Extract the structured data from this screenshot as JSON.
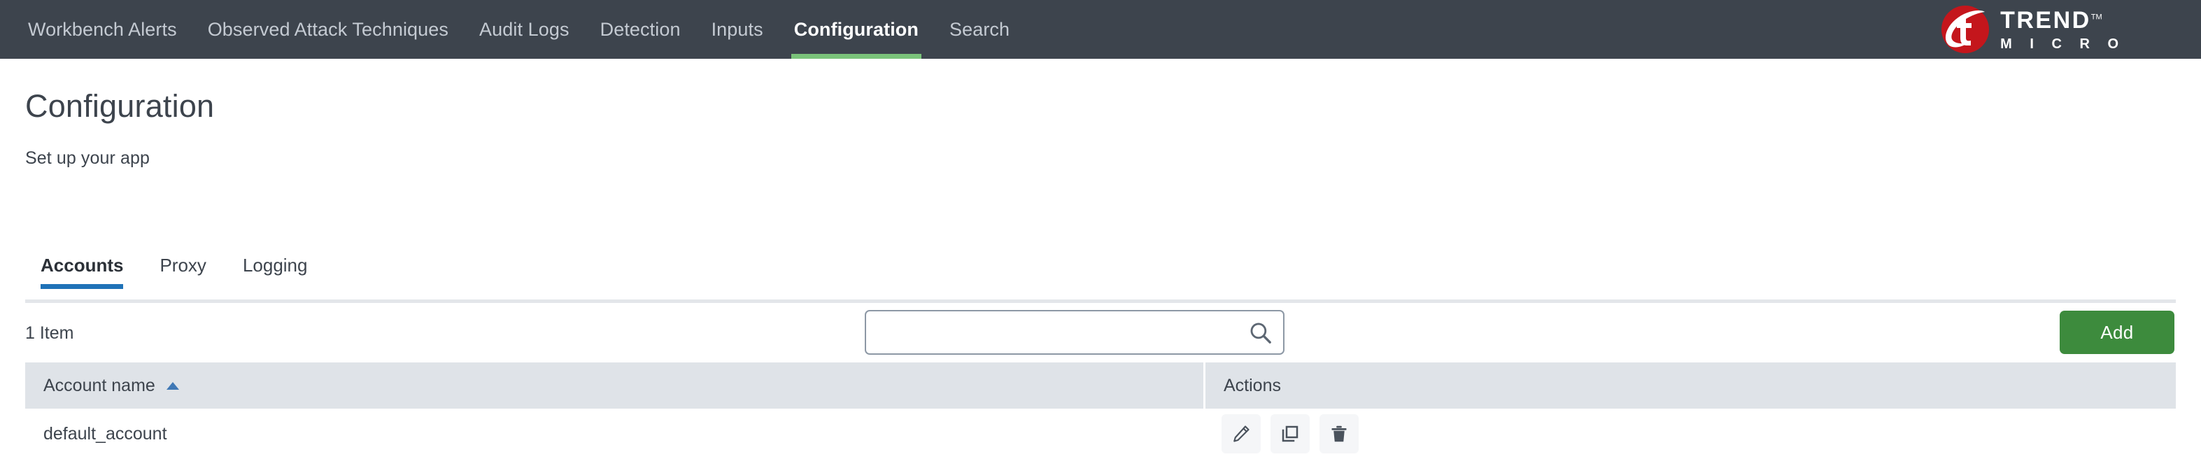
{
  "topnav": {
    "items": [
      {
        "label": "Workbench Alerts",
        "active": false
      },
      {
        "label": "Observed Attack Techniques",
        "active": false
      },
      {
        "label": "Audit Logs",
        "active": false
      },
      {
        "label": "Detection",
        "active": false
      },
      {
        "label": "Inputs",
        "active": false
      },
      {
        "label": "Configuration",
        "active": true
      },
      {
        "label": "Search",
        "active": false
      }
    ],
    "active_indicator_color": "#7ac37a",
    "background_color": "#3d444d"
  },
  "brand": {
    "name_line1": "TREND",
    "trademark": "TM",
    "name_line2": "M I C R O",
    "mark_color": "#c4161c"
  },
  "page": {
    "title": "Configuration",
    "subtitle": "Set up your app"
  },
  "subtabs": {
    "items": [
      {
        "label": "Accounts",
        "active": true
      },
      {
        "label": "Proxy",
        "active": false
      },
      {
        "label": "Logging",
        "active": false
      }
    ],
    "active_indicator_color": "#1f72b8"
  },
  "toolbar": {
    "item_count": "1 Item",
    "search_value": "",
    "search_placeholder": "",
    "search_icon": "search-icon",
    "add_label": "Add",
    "add_color": "#3d8b3d"
  },
  "table": {
    "columns": [
      {
        "label": "Account name",
        "sort": "ascending",
        "sort_icon": "sort-ascending-icon"
      },
      {
        "label": "Actions",
        "sort": null
      }
    ],
    "rows": [
      {
        "account_name": "default_account",
        "actions": [
          {
            "name": "edit",
            "icon": "pencil-icon"
          },
          {
            "name": "clone",
            "icon": "clone-icon"
          },
          {
            "name": "delete",
            "icon": "trash-icon"
          }
        ]
      }
    ],
    "header_background": "#dfe3e8"
  }
}
